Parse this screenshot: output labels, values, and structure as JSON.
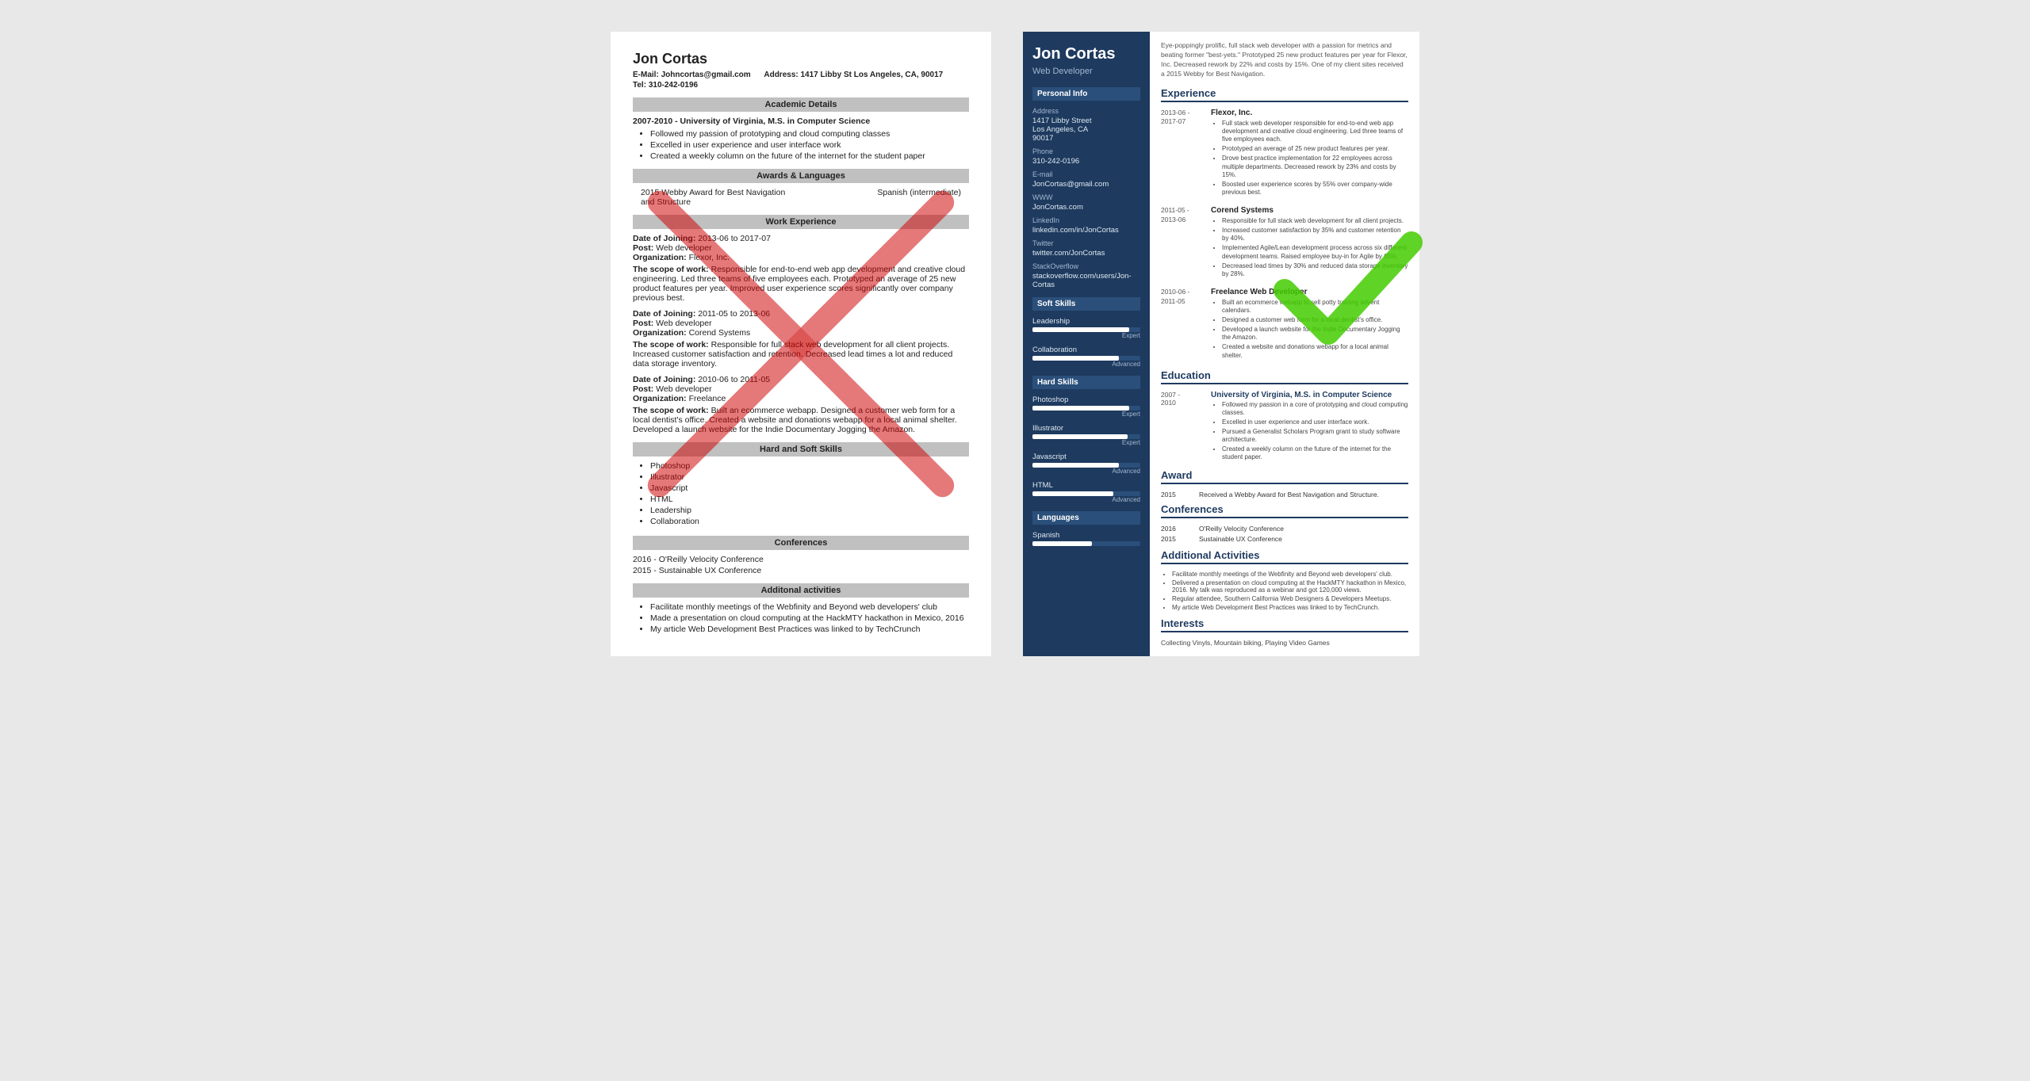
{
  "left_resume": {
    "name": "Jon Cortas",
    "email_label": "E-Mail:",
    "email": "Johncortas@gmail.com",
    "address_label": "Address:",
    "address": "1417 Libby St Los Angeles, CA, 90017",
    "tel_label": "Tel:",
    "tel": "310-242-0196",
    "academic_section": "Academic Details",
    "academic_entries": [
      {
        "date": "2007-2010 -",
        "title": "University of Virginia, M.S. in Computer Science",
        "bullets": [
          "Followed my passion of prototyping and cloud computing classes",
          "Excelled in user experience and user interface work",
          "Created a weekly column on the future of the internet for the student paper"
        ]
      }
    ],
    "awards_section": "Awards & Languages",
    "award_text": "2015 Webby Award for Best Navigation and Structure",
    "language_text": "Spanish (intermediate)",
    "work_section": "Work Experience",
    "work_entries": [
      {
        "date": "Date of Joining: 2013-06 to 2017-07",
        "post": "Post: Web developer",
        "org": "Organization: Flexor, Inc.",
        "scope": "The scope of work: Responsible for end-to-end web app development and creative cloud engineering. Led three teams of five employees each. Prototyped an average of 25 new product features per year. Improved user experience scores significantly over company previous best."
      },
      {
        "date": "Date of Joining: 2011-05 to 2013-06",
        "post": "Post: Web developer",
        "org": "Organization: Corend Systems",
        "scope": "The scope of work: Responsible for full stack web development for all client projects. Increased customer satisfaction and retention. Decreased lead times a lot and reduced data storage inventory."
      },
      {
        "date": "Date of Joining: 2010-06 to 2011-05",
        "post": "Post: Web developer",
        "org": "Organization: Freelance",
        "scope": "The scope of work: Built an ecommerce webapp. Designed a customer web form for a local dentist's office. Created a website and donations webapp for a local animal shelter. Developed a launch website for the Indie Documentary Jogging the Amazon."
      }
    ],
    "skills_section": "Hard and Soft Skills",
    "skills": [
      "Photoshop",
      "Illustrator",
      "Javascript",
      "HTML",
      "Leadership",
      "Collaboration"
    ],
    "conf_section": "Conferences",
    "conferences": [
      "2016 - O'Reilly Velocity Conference",
      "2015 - Sustainable UX Conference"
    ],
    "activities_section": "Additonal activities",
    "activities": [
      "Facilitate monthly meetings of the Webfinity and Beyond web developers' club",
      "Made a presentation on cloud computing at the HackMTY hackathon in Mexico, 2016",
      "My article Web Development Best Practices was linked to by TechCrunch"
    ]
  },
  "right_resume": {
    "name": "Jon Cortas",
    "title": "Web Developer",
    "intro": "Eye-poppingly prolific, full stack web developer with a passion for metrics and beating former \"best-yets.\" Prototyped 25 new product features per year for Flexor, Inc. Decreased rework by 22% and costs by 15%. One of my client sites received a 2015 Webby for Best Navigation.",
    "sidebar": {
      "personal_section": "Personal Info",
      "address_label": "Address",
      "address": "1417 Libby Street\nLos Angeles, CA\n90017",
      "phone_label": "Phone",
      "phone": "310-242-0196",
      "email_label": "E-mail",
      "email": "JonCortas@gmail.com",
      "www_label": "WWW",
      "www": "JonCortas.com",
      "linkedin_label": "LinkedIn",
      "linkedin": "linkedin.com/in/JonCortas",
      "twitter_label": "Twitter",
      "twitter": "twitter.com/JonCortas",
      "stackoverflow_label": "StackOverflow",
      "stackoverflow": "stackoverflow.com/users/Jon-Cortas",
      "soft_skills_section": "Soft Skills",
      "soft_skills": [
        {
          "name": "Leadership",
          "level": "Expert",
          "pct": 90
        },
        {
          "name": "Collaboration",
          "level": "Advanced",
          "pct": 80
        }
      ],
      "hard_skills_section": "Hard Skills",
      "hard_skills": [
        {
          "name": "Photoshop",
          "level": "Expert",
          "pct": 90
        },
        {
          "name": "Illustrator",
          "level": "Expert",
          "pct": 88
        },
        {
          "name": "Javascript",
          "level": "Advanced",
          "pct": 80
        },
        {
          "name": "HTML",
          "level": "Advanced",
          "pct": 75
        }
      ],
      "languages_section": "Languages",
      "languages": [
        {
          "name": "Spanish",
          "level": "",
          "pct": 55
        }
      ]
    },
    "experience_section": "Experience",
    "experience": [
      {
        "date": "2013-06 -\n2017-07",
        "company": "Flexor, Inc.",
        "bullets": [
          "Full stack web developer responsible for end-to-end web app development and creative cloud engineering. Led three teams of five employees each.",
          "Prototyped an average of 25 new product features per year.",
          "Drove best practice implementation for 22 employees across multiple departments. Decreased rework by 23% and costs by 15%.",
          "Boosted user experience scores by 55% over company-wide previous best."
        ]
      },
      {
        "date": "2011-05 -\n2013-06",
        "company": "Corend Systems",
        "bullets": [
          "Responsible for full stack web development for all client projects.",
          "Increased customer satisfaction by 35% and customer retention by 40%.",
          "Implemented Agile/Lean development process across six different development teams. Raised employee buy-in for Agile by 65%.",
          "Decreased lead times by 30% and reduced data storage inventory by 28%."
        ]
      },
      {
        "date": "2010-06 -\n2011-05",
        "company": "Freelance Web Developer",
        "bullets": [
          "Built an ecommerce webapp to sell potty training advent calendars.",
          "Designed a customer web form for a local dentist's office.",
          "Developed a launch website for the Indie Documentary Jogging the Amazon.",
          "Created a website and donations webapp for a local animal shelter."
        ]
      }
    ],
    "education_section": "Education",
    "education": [
      {
        "date": "2007 -\n2010",
        "school": "University of Virginia, M.S. in Computer Science",
        "bullets": [
          "Followed my passion in a core of prototyping and cloud computing classes.",
          "Excelled in user experience and user interface work.",
          "Pursued a Generalist Scholars Program grant to study software architecture.",
          "Created a weekly column on the future of the internet for the student paper."
        ]
      }
    ],
    "award_section": "Award",
    "award": {
      "year": "2015",
      "text": "Received a Webby Award for Best Navigation and Structure."
    },
    "conferences_section": "Conferences",
    "conferences": [
      {
        "year": "2016",
        "name": "O'Reilly Velocity Conference"
      },
      {
        "year": "2015",
        "name": "Sustainable UX Conference"
      }
    ],
    "activities_section": "Additional Activities",
    "activities": [
      "Facilitate monthly meetings of the Webfinity and Beyond web developers' club.",
      "Delivered a presentation on cloud computing at the HackMTY hackathon in Mexico, 2016. My talk was reproduced as a webinar and got 120,000 views.",
      "Regular attendee, Southern California Web Designers & Developers Meetups.",
      "My article Web Development Best Practices was linked to by TechCrunch."
    ],
    "interests_section": "Interests",
    "interests": "Collecting Vinyls, Mountain biking, Playing Video Games"
  }
}
